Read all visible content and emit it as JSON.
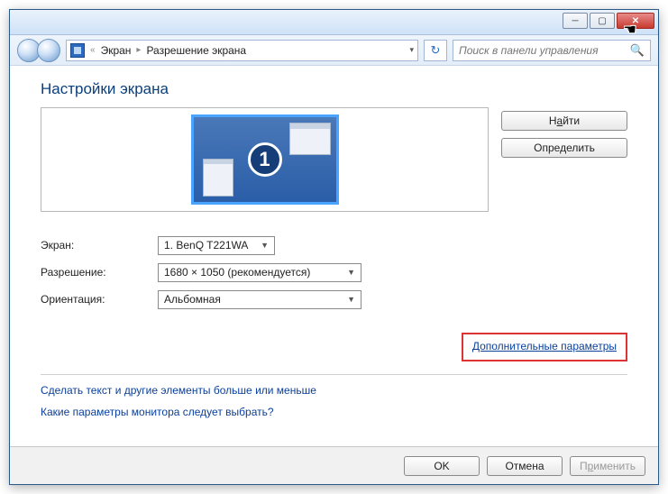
{
  "breadcrumb": {
    "item1": "Экран",
    "item2": "Разрешение экрана"
  },
  "search": {
    "placeholder": "Поиск в панели управления"
  },
  "heading": "Настройки экрана",
  "monitor_number": "1",
  "buttons": {
    "find_pre": "Н",
    "find_key": "а",
    "find_post": "йти",
    "identify": "Определить",
    "ok": "OK",
    "cancel": "Отмена",
    "apply_pre": "П",
    "apply_key": "р",
    "apply_post": "именить"
  },
  "labels": {
    "screen": "Экран:",
    "resolution": "Разрешение:",
    "orientation": "Ориентация:"
  },
  "values": {
    "screen": "1. BenQ T221WA",
    "resolution": "1680 × 1050 (рекомендуется)",
    "orientation": "Альбомная"
  },
  "links": {
    "advanced": "Дополнительные параметры",
    "text_size": "Сделать текст и другие элементы больше или меньше",
    "which_settings": "Какие параметры монитора следует выбрать?"
  }
}
